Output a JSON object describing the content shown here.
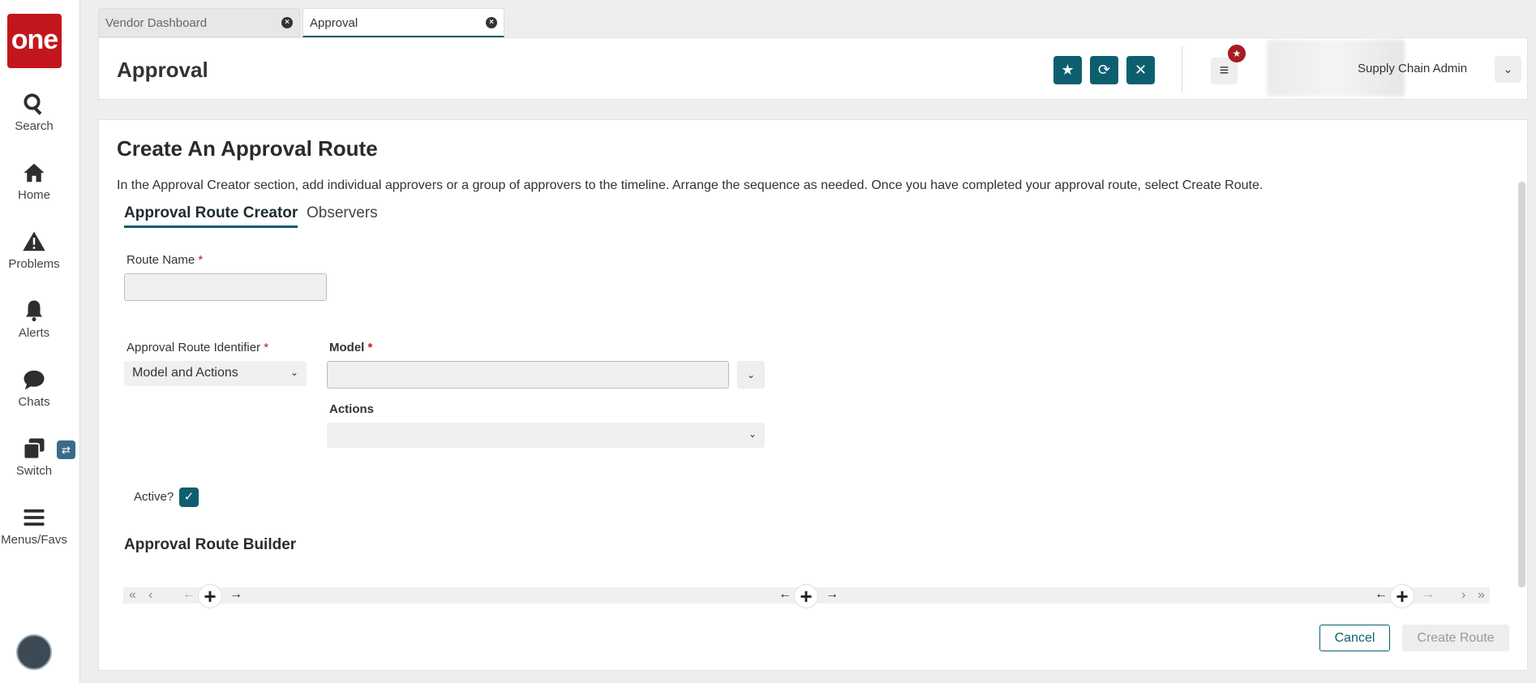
{
  "nav": {
    "logo": "one",
    "items": [
      {
        "label": "Search"
      },
      {
        "label": "Home"
      },
      {
        "label": "Problems"
      },
      {
        "label": "Alerts"
      },
      {
        "label": "Chats"
      },
      {
        "label": "Switch"
      },
      {
        "label": "Menus/Favs"
      }
    ]
  },
  "tabs": [
    {
      "label": "Vendor Dashboard"
    },
    {
      "label": "Approval"
    }
  ],
  "header": {
    "title": "Approval",
    "user_role": "Supply Chain Admin"
  },
  "main": {
    "title": "Create An Approval Route",
    "description": "In the Approval Creator section, add individual approvers or a group of approvers to the timeline. Arrange the sequence as needed. Once you have completed your approval route, select Create Route.",
    "subtabs": [
      "Approval Route Creator",
      "Observers"
    ],
    "route_name_label": "Route Name",
    "identifier_label": "Approval Route Identifier",
    "identifier_value": "Model and Actions",
    "model_label": "Model",
    "actions_label": "Actions",
    "active_label": "Active?",
    "builder_title": "Approval Route Builder",
    "cancel_label": "Cancel",
    "create_label": "Create Route"
  }
}
